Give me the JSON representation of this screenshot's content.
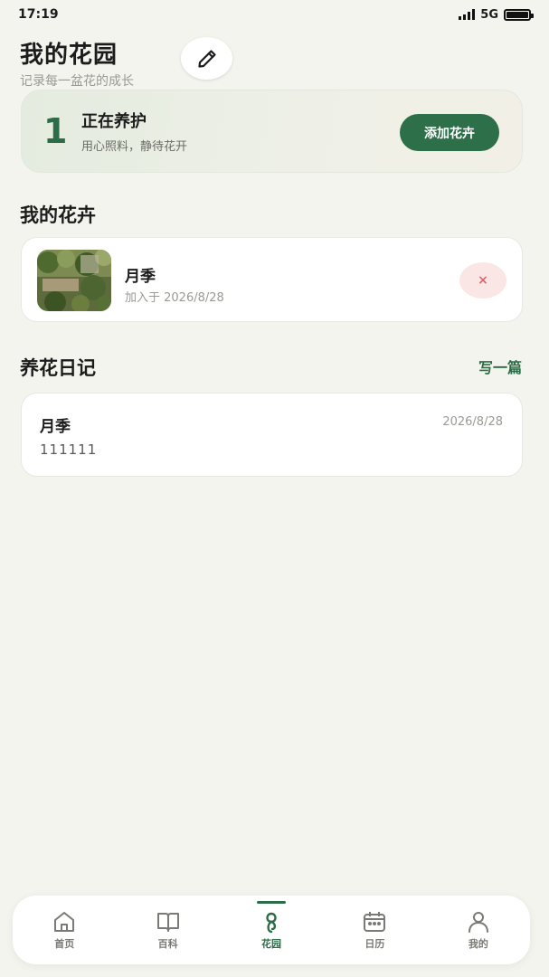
{
  "status_bar": {
    "time": "17:19",
    "network": "5G",
    "battery_level": 1.0
  },
  "header": {
    "title": "我的花园",
    "subtitle": "记录每一盆花的成长"
  },
  "summary": {
    "count": "1",
    "title": "正在养护",
    "subtitle": "用心照料，静待花开",
    "add_button": "添加花卉"
  },
  "plants_section": {
    "title": "我的花卉",
    "items": [
      {
        "name": "月季",
        "added": "加入于 2026/8/28",
        "delete_symbol": "×"
      }
    ]
  },
  "diary_section": {
    "title": "养花日记",
    "write_label": "写一篇",
    "items": [
      {
        "name": "月季",
        "date": "2026/8/28",
        "content": "111111"
      }
    ]
  },
  "tab_bar": {
    "items": [
      {
        "label": "首页",
        "icon": "home-icon"
      },
      {
        "label": "百科",
        "icon": "book-icon"
      },
      {
        "label": "花园",
        "icon": "flower-icon",
        "active": true
      },
      {
        "label": "日历",
        "icon": "calendar-icon"
      },
      {
        "label": "我的",
        "icon": "profile-icon"
      }
    ]
  },
  "colors": {
    "accent": "#2c6d48",
    "background": "#f4f4ee",
    "danger_bg": "#fbe6e6"
  }
}
